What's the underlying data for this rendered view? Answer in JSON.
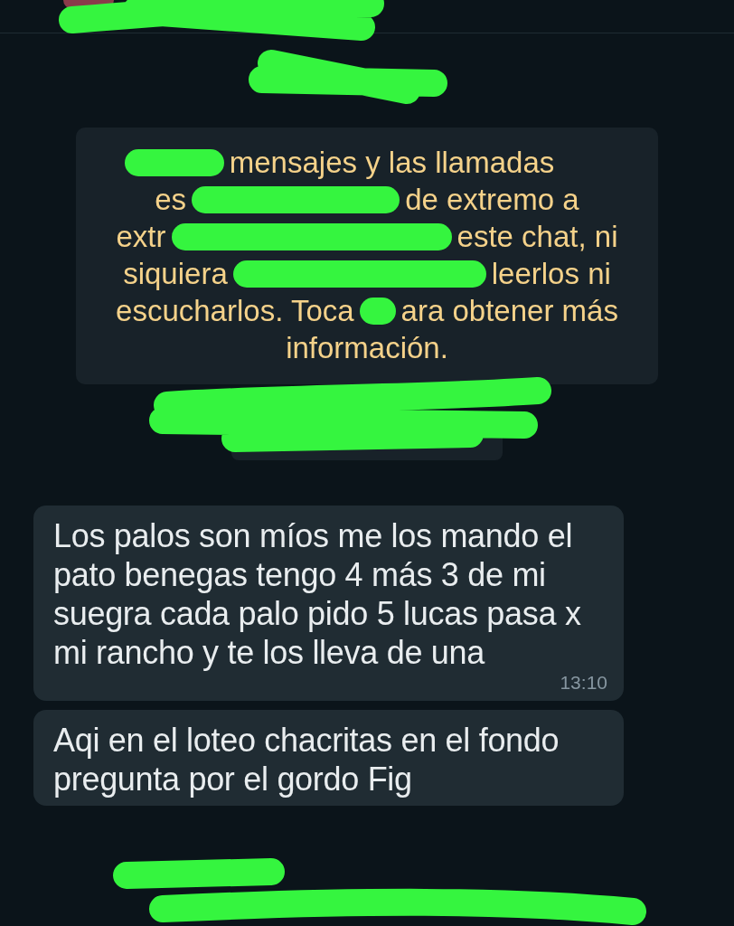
{
  "notice": {
    "lines": [
      [
        "mensajes y las llamadas"
      ],
      [
        "es",
        "de extremo a"
      ],
      [
        "extr",
        "este chat, ni"
      ],
      [
        "siquiera",
        "leerlos ni"
      ],
      [
        "escucharlos. Toca",
        "ara obtener más"
      ],
      [
        "información."
      ]
    ]
  },
  "messages": [
    {
      "text": "Los palos son míos me los mando el pato benegas tengo 4 más 3 de mi suegra cada palo pido 5 lucas pasa x mi rancho y te los lleva de una",
      "time": "13:10"
    },
    {
      "text": "Aqi en el loteo chacritas en el fondo pregunta por el gordo Fig"
    }
  ]
}
